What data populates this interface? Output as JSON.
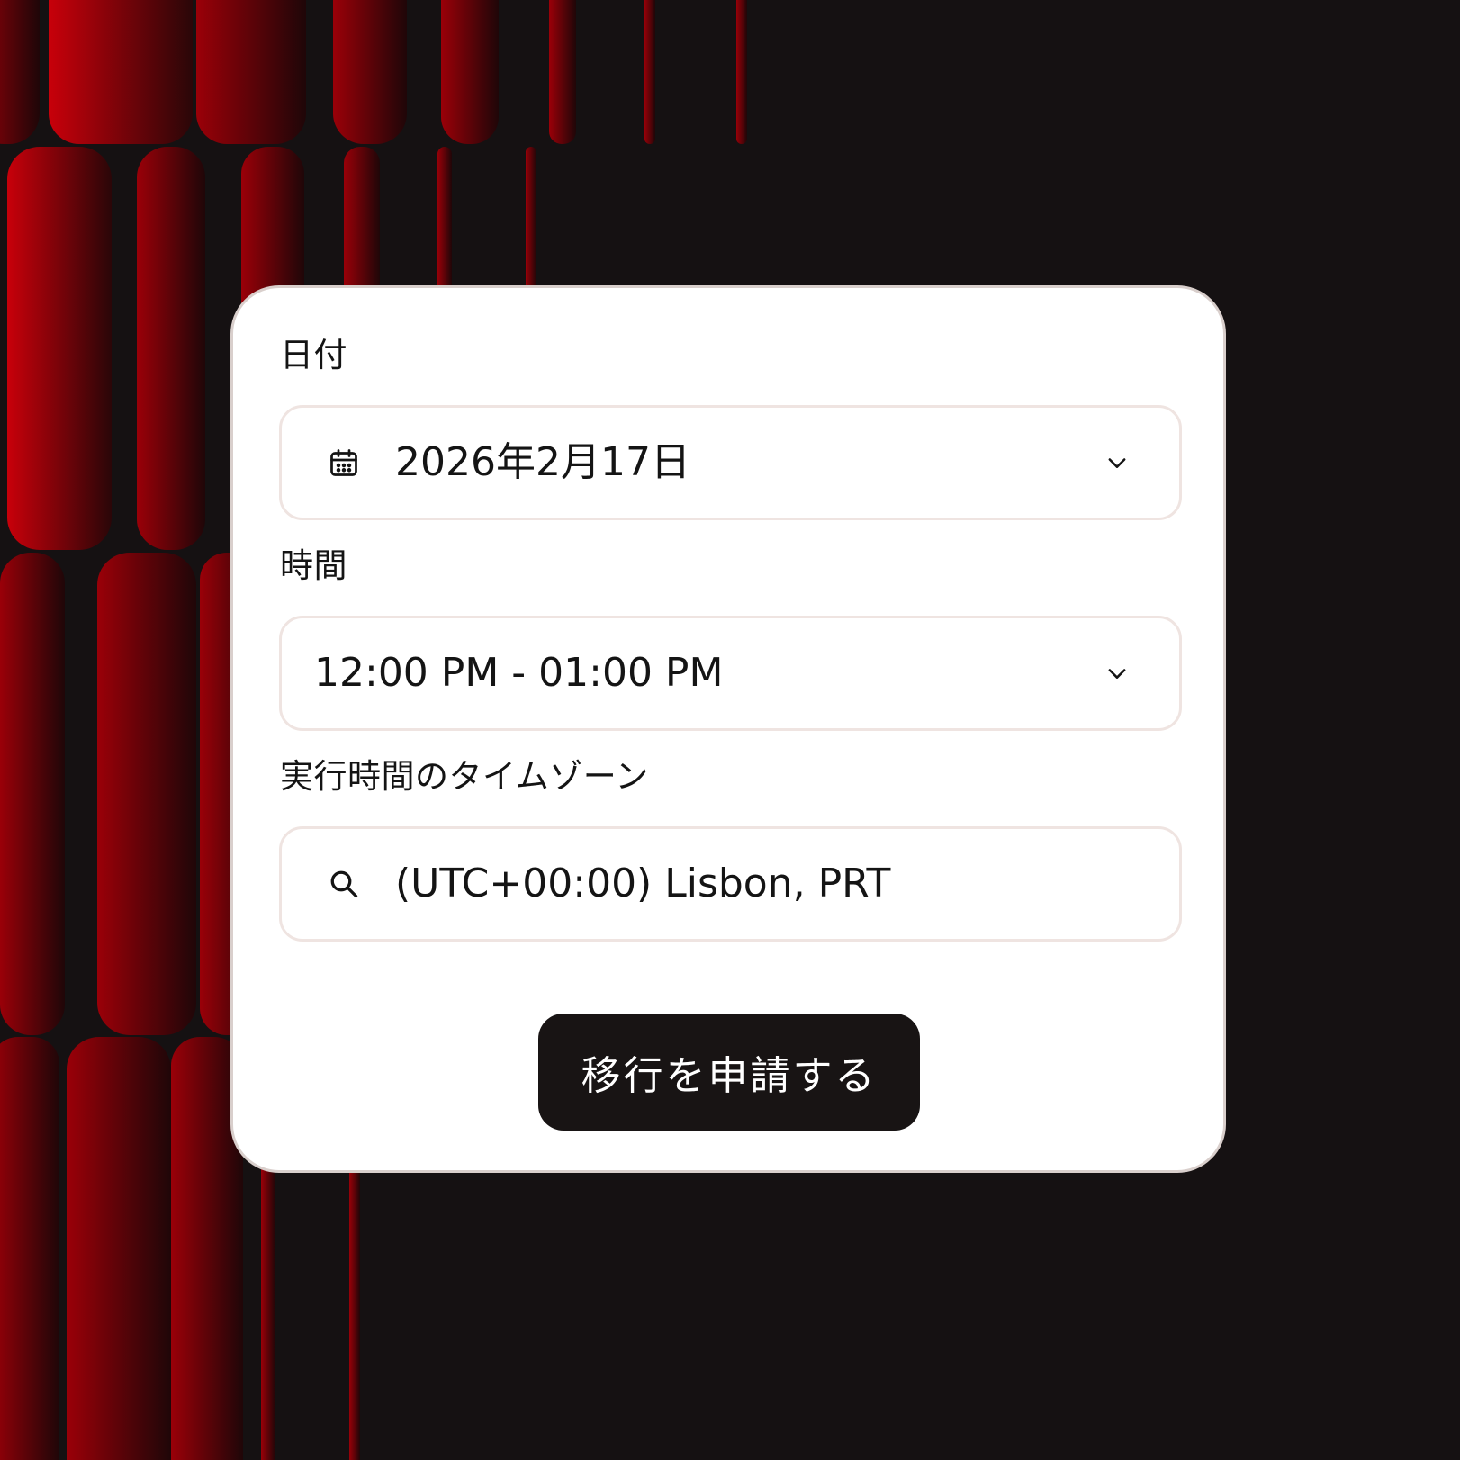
{
  "date_field": {
    "label": "日付",
    "value": "2026年2月17日",
    "icon": "calendar-icon",
    "dropdown_icon": "chevron-down-icon"
  },
  "time_field": {
    "label": "時間",
    "value": "12:00 PM - 01:00 PM",
    "dropdown_icon": "chevron-down-icon"
  },
  "timezone_field": {
    "label": "実行時間のタイムゾーン",
    "value": "(UTC+00:00) Lisbon, PRT",
    "icon": "search-icon"
  },
  "submit_button": {
    "label": "移行を申請する"
  },
  "colors": {
    "accent_red": "#c8000a",
    "background": "#151112",
    "card": "#ffffff",
    "button": "#181414"
  }
}
